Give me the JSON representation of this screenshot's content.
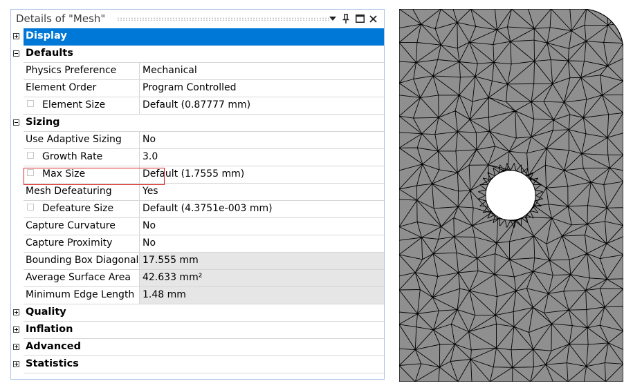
{
  "panel": {
    "title": "Details of \"Mesh\"",
    "buttons": {
      "menu": "dropdown",
      "pin": "pin",
      "maximize": "maximize",
      "close": "close"
    }
  },
  "categories": {
    "display": "Display",
    "defaults": "Defaults",
    "sizing": "Sizing",
    "quality": "Quality",
    "inflation": "Inflation",
    "advanced": "Advanced",
    "statistics": "Statistics"
  },
  "defaults": {
    "physics_preference": {
      "label": "Physics Preference",
      "value": "Mechanical"
    },
    "element_order": {
      "label": "Element Order",
      "value": "Program Controlled"
    },
    "element_size": {
      "label": "Element Size",
      "value": "Default (0.87777 mm)"
    }
  },
  "sizing": {
    "use_adaptive_sizing": {
      "label": "Use Adaptive Sizing",
      "value": "No"
    },
    "growth_rate": {
      "label": "Growth Rate",
      "value": "3.0"
    },
    "max_size": {
      "label": "Max Size",
      "value": "Default (1.7555 mm)"
    },
    "mesh_defeaturing": {
      "label": "Mesh Defeaturing",
      "value": "Yes"
    },
    "defeature_size": {
      "label": "Defeature Size",
      "value": "Default (4.3751e-003 mm)"
    },
    "capture_curvature": {
      "label": "Capture Curvature",
      "value": "No"
    },
    "capture_proximity": {
      "label": "Capture Proximity",
      "value": "No"
    },
    "bounding_box_diagonal": {
      "label": "Bounding Box Diagonal",
      "value": "17.555 mm"
    },
    "average_surface_area": {
      "label": "Average Surface Area",
      "value": "42.633 mm²"
    },
    "minimum_edge_length": {
      "label": "Minimum Edge Length",
      "value": "1.48 mm"
    }
  },
  "colors": {
    "selected": "#0078d7",
    "readonly": "#e6e6e6",
    "highlight": "#d62424",
    "mesh_fill": "#8f8f8f",
    "mesh_line": "#000000"
  }
}
